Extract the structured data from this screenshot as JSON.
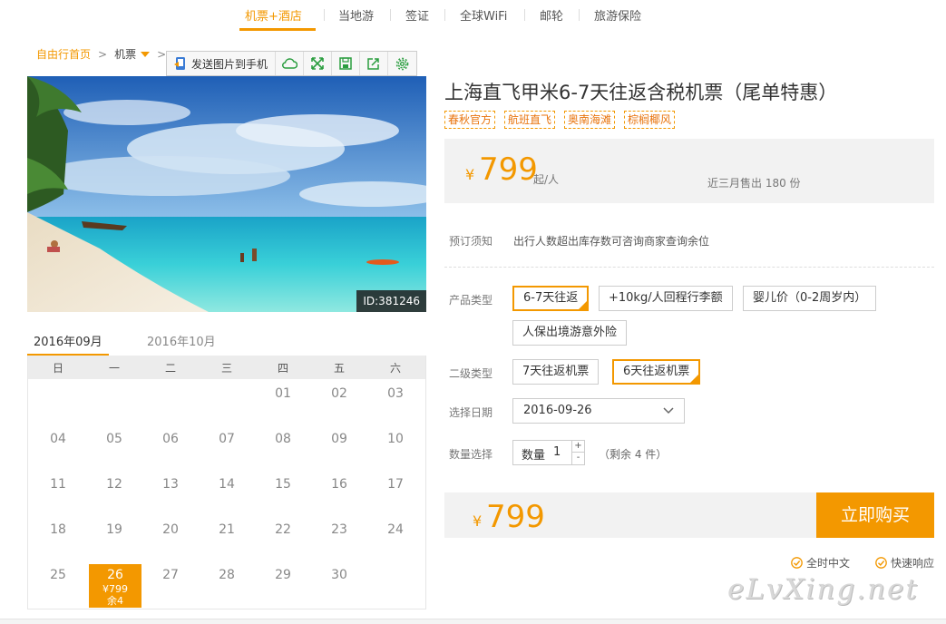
{
  "nav": {
    "items": [
      "机票+酒店",
      "当地游",
      "签证",
      "全球WiFi",
      "邮轮",
      "旅游保险"
    ]
  },
  "breadcrumb": {
    "home": "自由行首页",
    "ticket": "机票"
  },
  "toolbar": {
    "send_label": "发送图片到手机"
  },
  "photo": {
    "id_tag": "ID:381246"
  },
  "calendar": {
    "months": [
      "2016年09月",
      "2016年10月"
    ],
    "weekdays": [
      "日",
      "一",
      "二",
      "三",
      "四",
      "五",
      "六"
    ],
    "days": [
      "01",
      "02",
      "03",
      "04",
      "05",
      "06",
      "07",
      "08",
      "09",
      "10",
      "11",
      "12",
      "13",
      "14",
      "15",
      "16",
      "17",
      "18",
      "19",
      "20",
      "21",
      "22",
      "23",
      "24",
      "25",
      "26",
      "27",
      "28",
      "29",
      "30"
    ],
    "selected": {
      "day": "26",
      "price": "¥799",
      "remain": "余4"
    }
  },
  "product": {
    "title": "上海直飞甲米6-7天往返含税机票（尾单特惠）",
    "tags": [
      "春秋官方",
      "航班直飞",
      "奥南海滩",
      "棕榈椰风"
    ],
    "currency": "¥",
    "price": "799",
    "price_unit": "起/人",
    "sold": "近三月售出 180 份"
  },
  "booking": {
    "notice_label": "预订须知",
    "notice_text": "出行人数超出库存数可咨询商家查询余位",
    "type_label": "产品类型",
    "type_options": [
      "6-7天往返",
      "+10kg/人回程行李额",
      "婴儿价（0-2周岁内）",
      "人保出境游意外险"
    ],
    "subtype_label": "二级类型",
    "subtype_options": [
      "7天往返机票",
      "6天往返机票"
    ],
    "date_label": "选择日期",
    "date_value": "2016-09-26",
    "qty_label": "数量选择",
    "qty_field_label": "数量",
    "qty_value": "1",
    "plus": "+",
    "minus": "-",
    "remain": "（剩余 4 件）"
  },
  "buy": {
    "currency": "¥",
    "price": "799",
    "button": "立即购买"
  },
  "assurance": [
    "全时中文",
    "快速响应"
  ],
  "watermark": "eLvXing.net",
  "colors": {
    "accent": "#f39800"
  }
}
